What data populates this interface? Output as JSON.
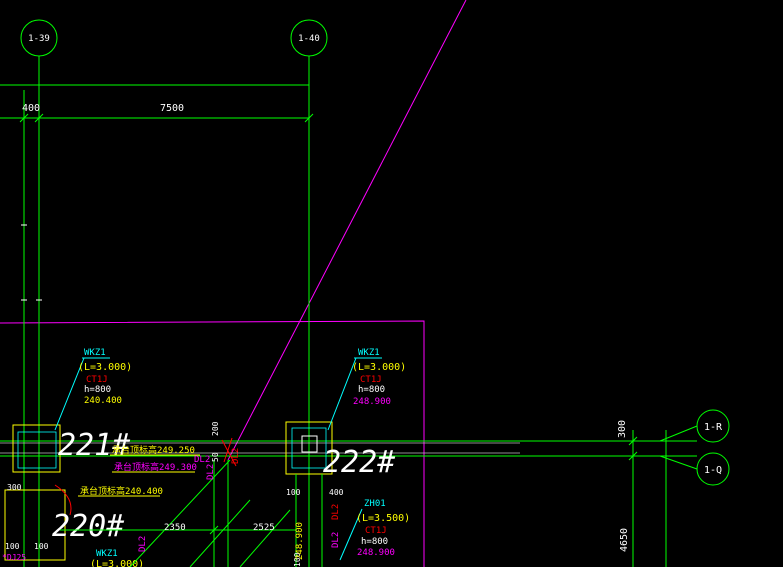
{
  "axes": {
    "a39": "1-39",
    "a40": "1-40",
    "aR": "1-R",
    "aQ": "1-Q"
  },
  "dims": {
    "d400": "400",
    "d7500": "7500",
    "d300": "300",
    "d4650": "4650",
    "d100a": "100",
    "d100b": "100",
    "d100c": "100",
    "d100d": "100",
    "d400b": "400",
    "d2350": "2350",
    "d2525": "2525",
    "d200": "200",
    "d50": "50",
    "d300b": "300"
  },
  "rooms": {
    "r221": "221#",
    "r222": "222#",
    "r220": "220#"
  },
  "col1": {
    "tag": "WKZ1",
    "len": "(L=3.000)",
    "cap": "CT1J",
    "h": "h=800",
    "elev": "240.400"
  },
  "col2": {
    "tag": "WKZ1",
    "len": "(L=3.000)",
    "cap": "CT1J",
    "h": "h=800",
    "elev": "248.900"
  },
  "col3": {
    "tag": "ZH01",
    "len": "(L=3.500)",
    "cap": "CT1J",
    "h": "h=800",
    "elev": "248.900"
  },
  "col4": {
    "tag": "WKZ1",
    "len": "(L=3.000)"
  },
  "notes": {
    "n1": "承台顶标高249.250",
    "n2": "承台顶标高249.300",
    "n3": "承台顶标高240.400",
    "dl2a": "DL2",
    "dl2b": "DL2",
    "dl2c": "DL2",
    "dl2d": "DL2",
    "dl2e": "DL2",
    "dl2f": "DL2",
    "v248": "248.900",
    "dj": "*DJ25"
  },
  "palette": {
    "green": "#00ff00",
    "cyan": "#00ffff",
    "yellow": "#ffff00",
    "magenta": "#ff00ff",
    "red": "#ff0000",
    "white": "#ffffff"
  }
}
